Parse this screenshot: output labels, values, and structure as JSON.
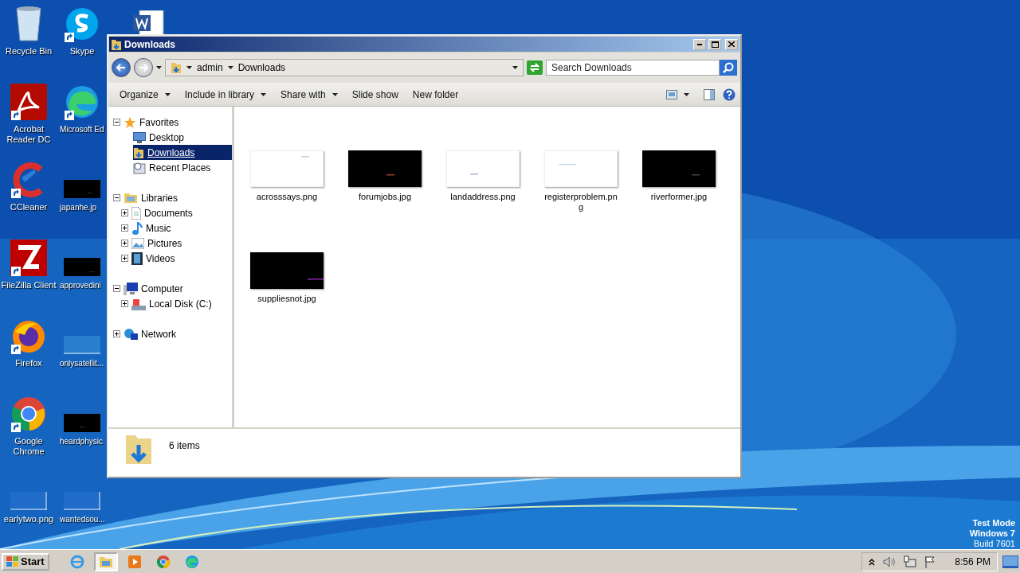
{
  "desktop_icons": [
    {
      "label": "Recycle Bin"
    },
    {
      "label": "Acrobat Reader DC"
    },
    {
      "label": "CCleaner"
    },
    {
      "label": "FileZilla Client"
    },
    {
      "label": "Firefox"
    },
    {
      "label": "Google Chrome"
    },
    {
      "label": "earlytwo.png"
    },
    {
      "label": "Skype"
    },
    {
      "label": "Microsoft Ed"
    },
    {
      "label": "japanhe.jp"
    },
    {
      "label": "approvedini"
    },
    {
      "label": "onlysatellit..."
    },
    {
      "label": "heardphysic"
    },
    {
      "label": "wantedsou..."
    }
  ],
  "window": {
    "title": "Downloads",
    "address": {
      "crumbs": [
        "admin",
        "Downloads"
      ]
    },
    "search": {
      "placeholder": "Search Downloads"
    },
    "toolbar": [
      {
        "label": "Organize",
        "kind": "menu"
      },
      {
        "label": "Include in library",
        "kind": "menu"
      },
      {
        "label": "Share with",
        "kind": "menu"
      },
      {
        "label": "Slide show",
        "kind": "button"
      },
      {
        "label": "New folder",
        "kind": "button"
      }
    ],
    "nav_tree": [
      {
        "label": "Favorites",
        "expanded": true,
        "selected": false,
        "children": [
          {
            "label": "Desktop",
            "selected": false
          },
          {
            "label": "Downloads",
            "selected": true
          },
          {
            "label": "Recent Places",
            "selected": false
          }
        ]
      },
      {
        "label": "Libraries",
        "expanded": true,
        "selected": false,
        "children": [
          {
            "label": "Documents",
            "expanded": false,
            "selected": false
          },
          {
            "label": "Music",
            "expanded": false,
            "selected": false
          },
          {
            "label": "Pictures",
            "expanded": false,
            "selected": false
          },
          {
            "label": "Videos",
            "expanded": false,
            "selected": false
          }
        ]
      },
      {
        "label": "Computer",
        "expanded": true,
        "selected": false,
        "children": [
          {
            "label": "Local Disk (C:)",
            "expanded": false,
            "selected": false
          }
        ]
      },
      {
        "label": "Network",
        "expanded": false,
        "selected": false
      }
    ],
    "files": [
      {
        "name": "acrosssays.png"
      },
      {
        "name": "forumjobs.jpg"
      },
      {
        "name": "landaddress.png"
      },
      {
        "name": "registerproblem.pn g"
      },
      {
        "name": "riverformer.jpg"
      },
      {
        "name": "suppliesnot.jpg"
      }
    ],
    "status": "6 items"
  },
  "taskbar": {
    "start": "Start",
    "apps": [
      {
        "selected": false
      },
      {
        "selected": true
      },
      {
        "selected": false
      },
      {
        "selected": false
      },
      {
        "selected": false
      }
    ],
    "clock": "8:56 PM"
  },
  "os_notice": [
    "Test Mode",
    "Windows 7",
    "Build 7601"
  ]
}
